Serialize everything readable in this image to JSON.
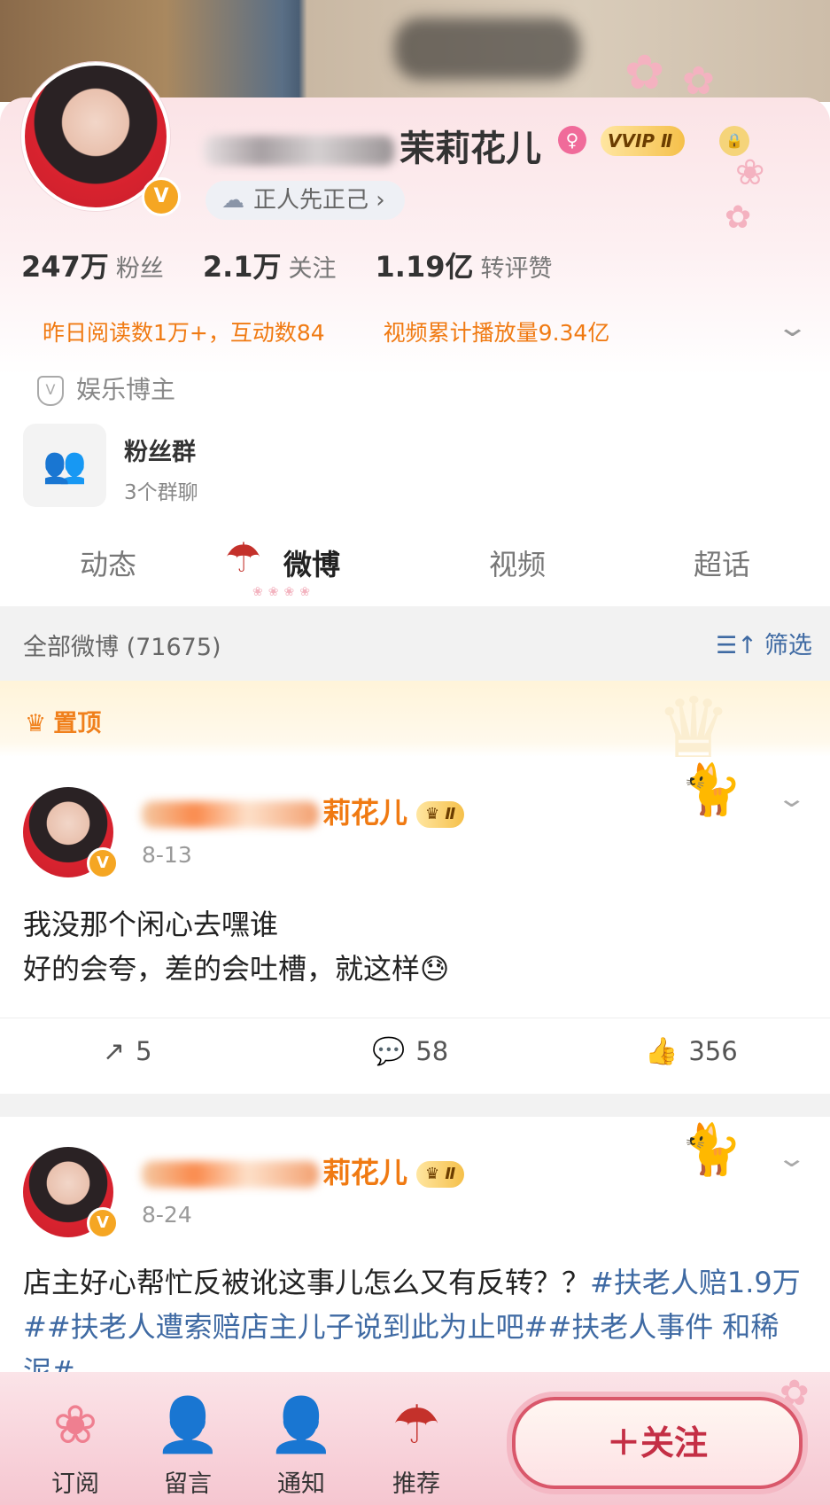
{
  "profile": {
    "nickname_visible": "茉莉花儿",
    "vip_badge": "VVIP Ⅱ",
    "bio": "正人先正己 ›",
    "stats": [
      {
        "num": "247万",
        "label": "粉丝"
      },
      {
        "num": "2.1万",
        "label": "关注"
      },
      {
        "num": "1.19亿",
        "label": "转评赞"
      }
    ],
    "reads": "昨日阅读数1万+，互动数84",
    "video": "视频累计播放量9.34亿",
    "category": "娱乐博主",
    "fans_group": {
      "title": "粉丝群",
      "sub": "3个群聊"
    }
  },
  "tabs": [
    "动态",
    "微博",
    "视频",
    "超话"
  ],
  "filter": {
    "all": "全部微博 (71675)",
    "button": "筛选"
  },
  "pinned_label": "置顶",
  "posts": [
    {
      "name_visible": "莉花儿",
      "crown": "Ⅱ",
      "date": "8-13",
      "line1": "我没那个闲心去嘿谁",
      "line2": "好的会夸，差的会吐槽，就这样",
      "emoji": "😓",
      "repost": "5",
      "comment": "58",
      "like": "356"
    },
    {
      "name_visible": "莉花儿",
      "crown": "Ⅱ",
      "date": "8-24",
      "text": "店主好心帮忙反被讹这事儿怎么又有反转？？",
      "topics": "#扶老人赔1.9万##扶老人遭索赔店主儿子说到此为止吧##扶老人事件 和稀泥#"
    }
  ],
  "bottom": {
    "items": [
      "订阅",
      "留言",
      "通知",
      "推荐"
    ],
    "follow": "＋关注"
  },
  "colors": {
    "accent_orange": "#f07a12",
    "link_blue": "#3f6aa3",
    "follow_red": "#c42f45"
  }
}
